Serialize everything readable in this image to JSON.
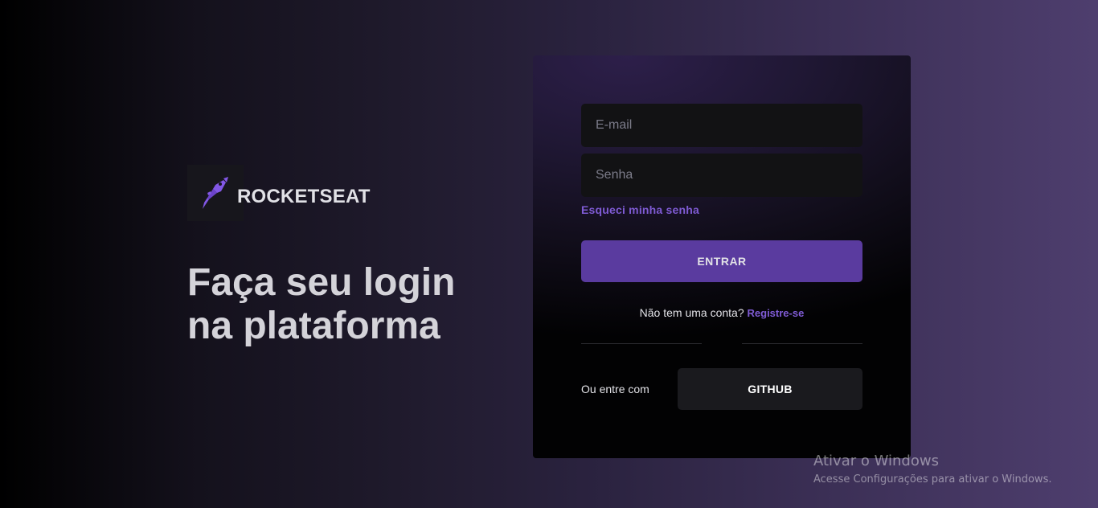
{
  "brand": {
    "name": "ROCKETSEAT",
    "logo_icon": "rocket-icon",
    "accent": "#8257e5"
  },
  "headline": {
    "line1": "Faça seu login",
    "line2": "na plataforma"
  },
  "form": {
    "email_placeholder": "E-mail",
    "password_placeholder": "Senha",
    "forgot_link": "Esqueci minha senha",
    "submit_label": "ENTRAR",
    "signup_text": "Não tem uma conta?",
    "signup_link": "Registre-se",
    "alt_login_label": "Ou entre com",
    "github_label": "GITHUB"
  },
  "colors": {
    "link": "#7f5bd4",
    "button_primary": "#5a3b9f",
    "input_bg": "#121214"
  },
  "watermark": {
    "title": "Ativar o Windows",
    "subtitle": "Acesse Configurações para ativar o Windows."
  }
}
